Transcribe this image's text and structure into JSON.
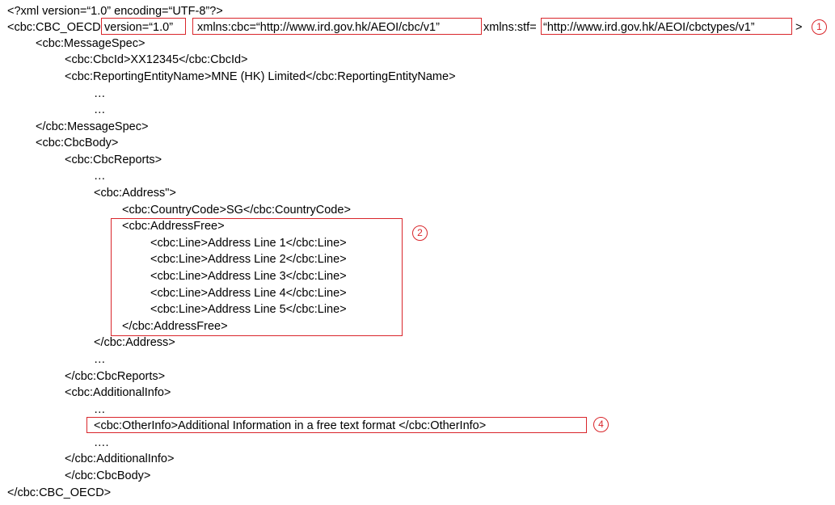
{
  "xml": {
    "decl": "<?xml version=“1.0” encoding=“UTF-8”?>",
    "root_open_tag": "<cbc:CBC_OECD",
    "root_version": "version=“1.0”",
    "root_xmlns_cbc": "xmlns:cbc=“http://www.ird.gov.hk/AEOI/cbc/v1”",
    "root_xmlns_stf_label": "xmlns:stf=",
    "root_xmlns_stf_value": "“http://www.ird.gov.hk/AEOI/cbctypes/v1”",
    "root_close_bracket": ">",
    "message_spec_open": "<cbc:MessageSpec>",
    "cbc_id": "<cbc:CbcId>XX12345</cbc:CbcId>",
    "reporting_entity": "<cbc:ReportingEntityName>MNE (HK) Limited</cbc:ReportingEntityName>",
    "ellipsis_a": "…",
    "ellipsis_b": "…",
    "message_spec_close": "</cbc:MessageSpec>",
    "cbc_body_open": "<cbc:CbcBody>",
    "cbc_reports_open": "<cbc:CbcReports>",
    "ellipsis_c": "…",
    "address_open": "<cbc:Address\">",
    "country_code": "<cbc:CountryCode>SG</cbc:CountryCode>",
    "address_free_open": "<cbc:AddressFree>",
    "address_lines": [
      "<cbc:Line>Address Line 1</cbc:Line>",
      "<cbc:Line>Address Line 2</cbc:Line>",
      "<cbc:Line>Address Line 3</cbc:Line>",
      "<cbc:Line>Address Line 4</cbc:Line>",
      "<cbc:Line>Address Line 5</cbc:Line>"
    ],
    "address_free_close": "</cbc:AddressFree>",
    "address_close": "</cbc:Address>",
    "ellipsis_d": "…",
    "cbc_reports_close": "</cbc:CbcReports>",
    "additional_info_open": "<cbc:AdditionalInfo>",
    "ellipsis_e": "…",
    "other_info": "<cbc:OtherInfo>Additional Information in a free text format </cbc:OtherInfo>",
    "ellipsis_f": "….",
    "additional_info_close": "</cbc:AdditionalInfo>",
    "cbc_body_close": "</cbc:CbcBody>",
    "root_close": "</cbc:CBC_OECD>"
  },
  "markers": [
    "1",
    "2",
    "4"
  ],
  "colors": {
    "highlight": "#d9262b",
    "text": "#000000"
  }
}
